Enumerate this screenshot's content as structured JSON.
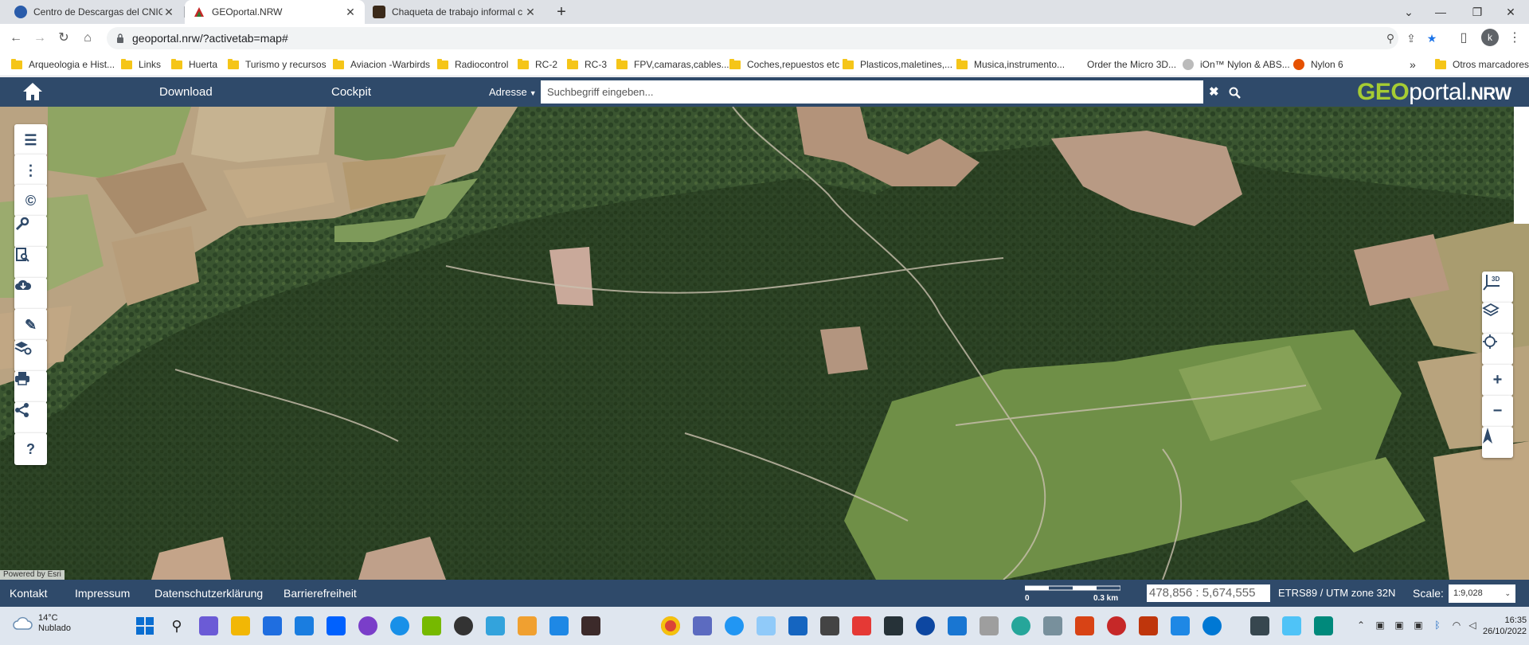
{
  "browser": {
    "tabs": [
      {
        "title": "Centro de Descargas del CNIG (I",
        "active": false,
        "favicon_color": "#2a5caa"
      },
      {
        "title": "GEOportal.NRW",
        "active": true,
        "favicon_color": "#c62828"
      },
      {
        "title": "Chaqueta de trabajo informal c",
        "active": false,
        "favicon_color": "#3b2a1a"
      }
    ],
    "new_tab": "+",
    "window": {
      "chevron": "⌄",
      "minimize": "—",
      "restore": "❐",
      "close": "✕"
    },
    "url": "geoportal.nrw/?activetab=map#",
    "avatar_letter": "k"
  },
  "bookmarks": [
    {
      "label": "Arqueologia e Hist...",
      "icon": "folder"
    },
    {
      "label": "Links",
      "icon": "folder"
    },
    {
      "label": "Huerta",
      "icon": "folder"
    },
    {
      "label": "Turismo y recursos",
      "icon": "folder"
    },
    {
      "label": "Aviacion -Warbirds",
      "icon": "folder"
    },
    {
      "label": "Radiocontrol",
      "icon": "folder"
    },
    {
      "label": "RC-2",
      "icon": "folder"
    },
    {
      "label": "RC-3",
      "icon": "folder"
    },
    {
      "label": "FPV,camaras,cables...",
      "icon": "folder"
    },
    {
      "label": "Coches,repuestos etc",
      "icon": "folder"
    },
    {
      "label": "Plasticos,maletines,...",
      "icon": "folder"
    },
    {
      "label": "Musica,instrumento...",
      "icon": "folder"
    },
    {
      "label": "Order the Micro 3D...",
      "icon": "none"
    },
    {
      "label": "iOn™ Nylon & ABS...",
      "icon": "site"
    },
    {
      "label": "Nylon 6",
      "icon": "site"
    }
  ],
  "bookmarks_overflow": "»",
  "bookmarks_other": "Otros marcadores",
  "geoportal": {
    "nav": {
      "download": "Download",
      "cockpit": "Cockpit"
    },
    "search": {
      "mode": "Adresse",
      "placeholder": "Suchbegriff eingeben..."
    },
    "logo": {
      "geo": "GEO",
      "portal": "portal",
      "nrw": ".NRW"
    },
    "colors": {
      "header": "#2f4a6a",
      "logo_green": "#a6cc33"
    }
  },
  "map": {
    "left_tools": [
      {
        "name": "legend-list",
        "glyph": "☰"
      },
      {
        "name": "more",
        "glyph": "⋮"
      },
      {
        "name": "copyright",
        "glyph": "©"
      },
      {
        "name": "tools",
        "glyph": "🔧"
      },
      {
        "name": "search-document",
        "glyph": "🔍"
      },
      {
        "name": "download",
        "glyph": "⬇"
      },
      {
        "name": "draw",
        "glyph": "✎"
      },
      {
        "name": "layers-settings",
        "glyph": "≋"
      },
      {
        "name": "print",
        "glyph": "⎙"
      },
      {
        "name": "share",
        "glyph": "⋖"
      },
      {
        "name": "help",
        "glyph": "?"
      }
    ],
    "right_tools": [
      {
        "name": "3d-view",
        "glyph": "3D"
      },
      {
        "name": "layers",
        "glyph": "◈"
      },
      {
        "name": "locate",
        "glyph": "⌖"
      },
      {
        "name": "zoom-in",
        "glyph": "+"
      },
      {
        "name": "zoom-out",
        "glyph": "−"
      },
      {
        "name": "north-arrow",
        "glyph": "▲"
      }
    ],
    "attribution": "Powered by Esri"
  },
  "footer": {
    "links": [
      "Kontakt",
      "Impressum",
      "Datenschutzerklärung",
      "Barrierefreiheit"
    ],
    "scale_bar": {
      "start": "0",
      "end": "0.3 km"
    },
    "coords": "478,856 : 5,674,555",
    "crs": "ETRS89 / UTM zone 32N",
    "scale_label": "Scale:",
    "scale_value": "1:9,028"
  },
  "taskbar": {
    "weather_temp": "14°C",
    "weather_desc": "Nublado",
    "time": "16:35",
    "date": "26/10/2022"
  }
}
